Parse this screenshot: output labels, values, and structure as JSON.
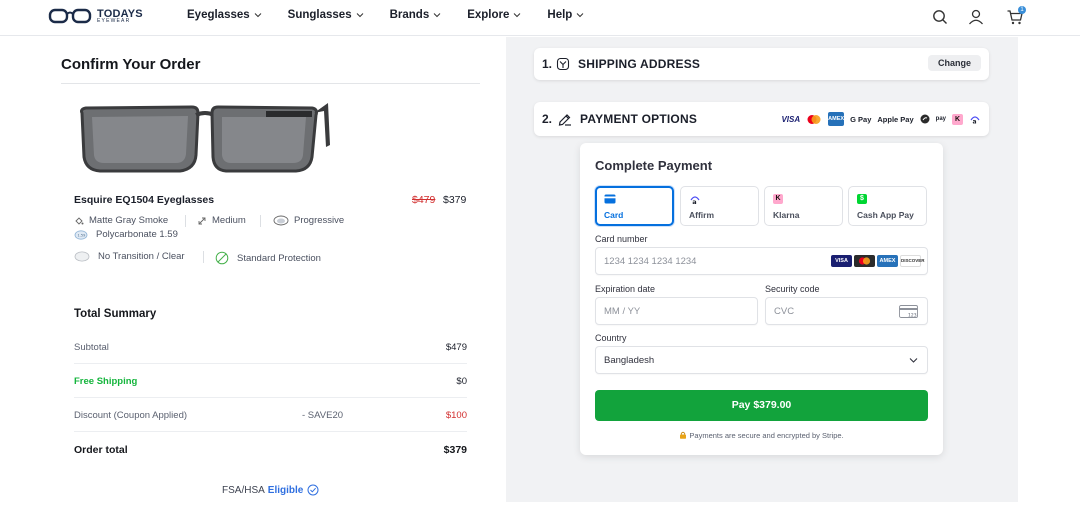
{
  "header": {
    "logo_text": "TODAYS",
    "logo_sub": "EYEWEAR",
    "nav": [
      "Eyeglasses",
      "Sunglasses",
      "Brands",
      "Explore",
      "Help"
    ],
    "cart_count": "1"
  },
  "order": {
    "title": "Confirm Your Order",
    "product_name": "Esquire EQ1504 Eyeglasses",
    "price_old": "$479",
    "price_new": "$379",
    "specs": {
      "color": "Matte Gray Smoke",
      "size": "Medium",
      "lens_type": "Progressive",
      "material": "Polycarbonate 1.59",
      "transition": "No Transition / Clear",
      "protection": "Standard Protection"
    }
  },
  "summary": {
    "title": "Total Summary",
    "rows": [
      {
        "label": "Subtotal",
        "mid": "",
        "value": "$479"
      },
      {
        "label": "Free Shipping",
        "mid": "",
        "value": "$0"
      },
      {
        "label": "Discount (Coupon Applied)",
        "mid": "- SAVE20",
        "value": "$100"
      },
      {
        "label": "Order total",
        "mid": "",
        "value": "$379"
      }
    ],
    "fsa_text": "FSA/HSA",
    "fsa_eligible": "Eligible"
  },
  "checkout": {
    "step1_num": "1.",
    "step1_title": "SHIPPING ADDRESS",
    "change_label": "Change",
    "step2_num": "2.",
    "step2_title": "PAYMENT OPTIONS",
    "payment_logos": [
      "VISA",
      "Mastercard",
      "AMEX",
      "G Pay",
      "Apple Pay",
      "Cash App",
      "Amazon Pay",
      "Klarna",
      "Affirm"
    ],
    "form": {
      "title": "Complete Payment",
      "methods": [
        "Card",
        "Affirm",
        "Klarna",
        "Cash App Pay"
      ],
      "card_number_label": "Card number",
      "card_number_placeholder": "1234 1234 1234 1234",
      "expiry_label": "Expiration date",
      "expiry_placeholder": "MM / YY",
      "cvc_label": "Security code",
      "cvc_placeholder": "CVC",
      "country_label": "Country",
      "country_value": "Bangladesh",
      "pay_button": "Pay $379.00",
      "secure_note": "Payments are secure and encrypted by Stripe."
    }
  },
  "colors": {
    "accent_blue": "#0570de",
    "pay_green": "#12a33c",
    "price_red": "#d22f2f",
    "free_green": "#14b53c"
  }
}
